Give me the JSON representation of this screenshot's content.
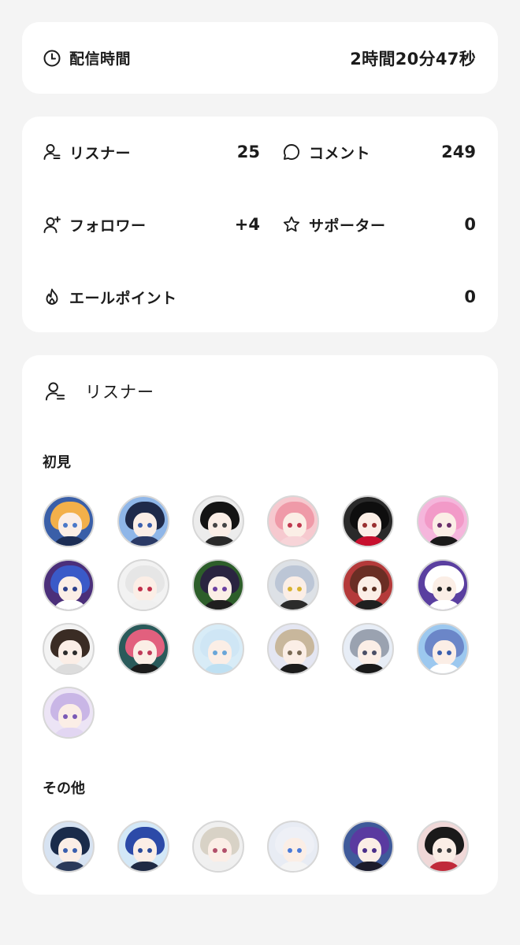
{
  "stream_time": {
    "label": "配信時間",
    "value": "2時間20分47秒",
    "icon": "clock-icon"
  },
  "stats": {
    "listeners": {
      "label": "リスナー",
      "value": "25",
      "icon": "person-list-icon"
    },
    "comments": {
      "label": "コメント",
      "value": "249",
      "icon": "speech-bubble-icon"
    },
    "followers": {
      "label": "フォロワー",
      "value": "+4",
      "icon": "person-add-icon"
    },
    "supporters": {
      "label": "サポーター",
      "value": "0",
      "icon": "star-icon"
    },
    "yell_points": {
      "label": "エールポイント",
      "value": "0",
      "icon": "flame-icon"
    }
  },
  "listeners_section": {
    "title": "リスナー",
    "groups": [
      {
        "title": "初見",
        "avatars": [
          {
            "bg": "#3a5fa8",
            "hair": "#f3b04a",
            "eye": "#4a78c8",
            "cloth": "#1c2d55"
          },
          {
            "bg": "#8fb6e8",
            "hair": "#1f2a4a",
            "eye": "#3b5fae",
            "cloth": "#2b3a66"
          },
          {
            "bg": "#ececec",
            "hair": "#141414",
            "eye": "#444444",
            "cloth": "#2a2a2a"
          },
          {
            "bg": "#f6c9cf",
            "hair": "#ef9aa8",
            "eye": "#c0394f",
            "cloth": "#f7d4d8"
          },
          {
            "bg": "#2a2a2a",
            "hair": "#0e0e0e",
            "eye": "#9a2f2f",
            "cloth": "#c8102e"
          },
          {
            "bg": "#f5b6dc",
            "hair": "#f29ac8",
            "eye": "#6b2f6b",
            "cloth": "#1a1a1a"
          },
          {
            "bg": "#4b2f7a",
            "hair": "#3a5ac8",
            "eye": "#2c3f8a",
            "cloth": "#ffffff"
          },
          {
            "bg": "#f2f2f2",
            "hair": "#e6e6e6",
            "eye": "#c0304a",
            "cloth": "#f0f0f0"
          },
          {
            "bg": "#2d5e2a",
            "hair": "#2a2440",
            "eye": "#6a3fa0",
            "cloth": "#1f1f1f"
          },
          {
            "bg": "#dde1e6",
            "hair": "#bcc6d6",
            "eye": "#d8b230",
            "cloth": "#2b2b2b"
          },
          {
            "bg": "#b43a3a",
            "hair": "#6a2e24",
            "eye": "#5a2d1f",
            "cloth": "#1f1f1f"
          },
          {
            "bg": "#5a3fa0",
            "hair": "#ffffff",
            "eye": "#222222",
            "cloth": "#ffffff"
          },
          {
            "bg": "#f3f3f3",
            "hair": "#3a2c24",
            "eye": "#2b2b2b",
            "cloth": "#dcdcdc"
          },
          {
            "bg": "#2a5a5a",
            "hair": "#e2607e",
            "eye": "#c03a5a",
            "cloth": "#1c1c1c"
          },
          {
            "bg": "#d8ecf7",
            "hair": "#cfe6f5",
            "eye": "#6aa6d8",
            "cloth": "#bfe0f2"
          },
          {
            "bg": "#e4e6f2",
            "hair": "#c8b79c",
            "eye": "#7a6a55",
            "cloth": "#1c1c1c"
          },
          {
            "bg": "#e7edf6",
            "hair": "#9aa2b0",
            "eye": "#4a4f66",
            "cloth": "#1a1a1a"
          },
          {
            "bg": "#9cc8ef",
            "hair": "#6b86c8",
            "eye": "#3a5fae",
            "cloth": "#ffffff"
          },
          {
            "bg": "#ece4f5",
            "hair": "#c9b6e6",
            "eye": "#7a5ab6",
            "cloth": "#e2d6f2"
          }
        ]
      },
      {
        "title": "その他",
        "avatars": [
          {
            "bg": "#d7e3f2",
            "hair": "#1a2b4a",
            "eye": "#3a5fae",
            "cloth": "#2a3a5a"
          },
          {
            "bg": "#d3e8f7",
            "hair": "#2c4aa8",
            "eye": "#2a4a9a",
            "cloth": "#1f2a44"
          },
          {
            "bg": "#f0f0f0",
            "hair": "#d8d2c6",
            "eye": "#b2506a",
            "cloth": "#efefef"
          },
          {
            "bg": "#e8ecf4",
            "hair": "#eef0f6",
            "eye": "#4a7ad8",
            "cloth": "#f4f4f4"
          },
          {
            "bg": "#3f5a9a",
            "hair": "#5a3aa0",
            "eye": "#4a2f8a",
            "cloth": "#1c1c2c"
          },
          {
            "bg": "#f0d8d8",
            "hair": "#1a1a1a",
            "eye": "#3a3a3a",
            "cloth": "#c02a3a"
          }
        ]
      }
    ]
  }
}
